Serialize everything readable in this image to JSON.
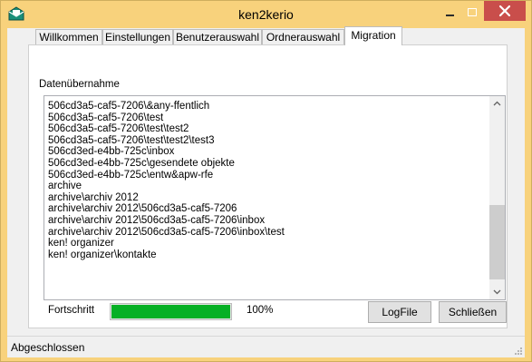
{
  "window": {
    "title": "ken2kerio",
    "colors": {
      "frame": "#f8d27c",
      "close": "#c94e4b",
      "accent": "#06b025"
    }
  },
  "icons": {
    "app": "envelope-icon",
    "minimize": "minimize-icon",
    "maximize": "maximize-icon",
    "close": "close-icon"
  },
  "tabs": [
    {
      "label": "Willkommen",
      "active": false
    },
    {
      "label": "Einstellungen",
      "active": false
    },
    {
      "label": "Benutzerauswahl",
      "active": false
    },
    {
      "label": "Ordnerauswahl",
      "active": false
    },
    {
      "label": "Migration",
      "active": true
    }
  ],
  "migration": {
    "group_label": "Datenübernahme",
    "items": [
      "506cd3a5-caf5-7206\\&any-ffentlich",
      "506cd3a5-caf5-7206\\test",
      "506cd3a5-caf5-7206\\test\\test2",
      "506cd3a5-caf5-7206\\test\\test2\\test3",
      "506cd3ed-e4bb-725c\\inbox",
      "506cd3ed-e4bb-725c\\gesendete objekte",
      "506cd3ed-e4bb-725c\\entw&apw-rfe",
      "archive",
      "archive\\archiv 2012",
      "archive\\archiv 2012\\506cd3a5-caf5-7206",
      "archive\\archiv 2012\\506cd3a5-caf5-7206\\inbox",
      "archive\\archiv 2012\\506cd3a5-caf5-7206\\inbox\\test",
      "ken! organizer",
      "ken! organizer\\kontakte"
    ],
    "progress_label": "Fortschritt",
    "progress_value": 1.0,
    "progress_text": "100%",
    "logfile_button": "LogFile",
    "close_button": "Schließen"
  },
  "status": {
    "text": "Abgeschlossen"
  }
}
